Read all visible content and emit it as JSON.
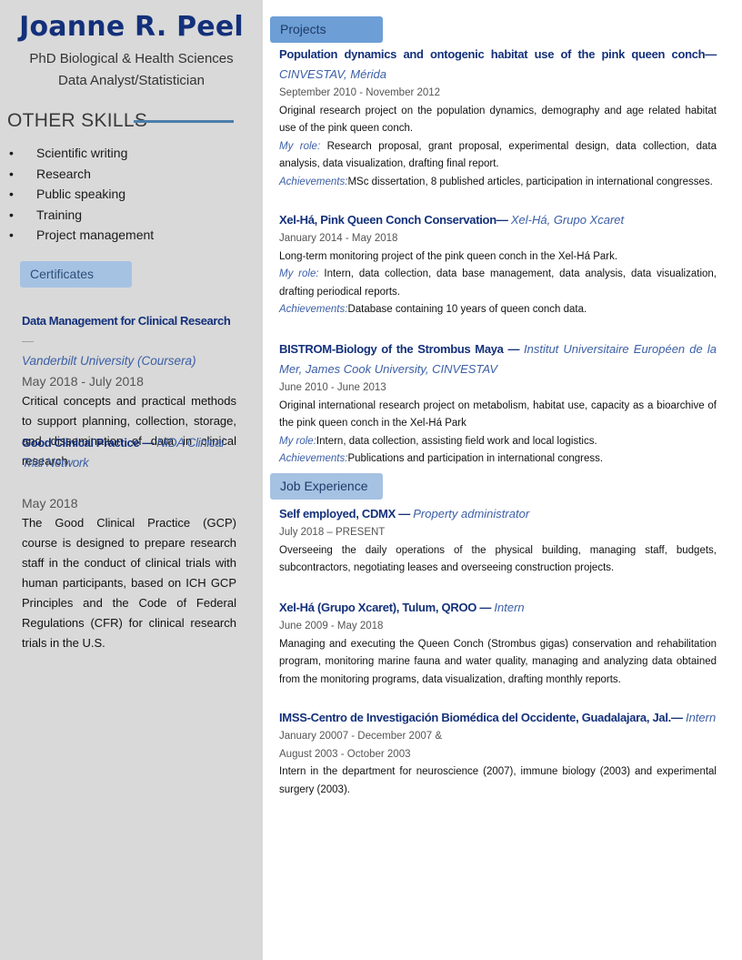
{
  "header": {
    "name": "Joanne R. Peel",
    "subtitle_1": "PhD Biological & Health Sciences",
    "subtitle_2": "Data Analyst/Statistician"
  },
  "skills": {
    "heading": "OTHER SKILLS",
    "items": [
      "Scientific writing",
      "Research",
      "Public speaking",
      "Training",
      "Project management"
    ]
  },
  "certificates": {
    "heading": "Certificates",
    "items": [
      {
        "title": "Data Management for Clinical Research",
        "dash": " —",
        "org": "Vanderbilt University (Coursera)",
        "date": "May 2018 - July 2018",
        "description": "Critical concepts and practical methods to support planning, collection, storage, and dissemination of data in clinical research."
      },
      {
        "title": "Good Clinical Practice",
        "dash": " — ",
        "org": "NIDA Clinical Trial Network",
        "date": "May 2018",
        "description": "The Good Clinical Practice (GCP) course is designed to prepare research staff in the conduct of clinical trials with human participants, based on ICH GCP Principles and the Code of Federal Regulations (CFR) for clinical research trials in the U.S."
      }
    ]
  },
  "projects": {
    "heading": "Projects",
    "role_label": "My role:",
    "achievements_label": "Achievements:",
    "items": [
      {
        "title": "Population dynamics and ontogenic habitat use of the pink queen conch",
        "dash": "—",
        "org": "CINVESTAV, Mérida",
        "date": "September 2010 - November 2012",
        "description": "Original research project on the population dynamics, demography and age related habitat use of the pink queen conch.",
        "role": "Research proposal, grant proposal, experimental design, data collection, data analysis, data visualization, drafting final report.",
        "achievements": "MSc dissertation, 8 published articles, participation in international congresses."
      },
      {
        "title": "Xel-Há, Pink Queen Conch Conservation",
        "dash": "— ",
        "org": "Xel-Há, Grupo Xcaret",
        "date": "January 2014 - May 2018",
        "description": "Long-term monitoring project of the pink queen conch in the Xel-Há Park.",
        "role": "Intern, data collection, data base management, data analysis, data visualization, drafting periodical reports.",
        "achievements": "Database containing 10 years of queen conch data."
      },
      {
        "title": "BISTROM-Biology of the Strombus Maya",
        "dash": " — ",
        "org": "Institut Universitaire Européen de la Mer, James Cook University, CINVESTAV",
        "date": "June 2010 - June 2013",
        "description": "Original international research project on metabolism, habitat use, capacity as a bioarchive of the pink queen conch in the Xel-Há Park",
        "role": "Intern, data collection, assisting field work and local logistics.",
        "achievements": "Publications and participation in international congress."
      }
    ]
  },
  "experience": {
    "heading": "Job Experience",
    "items": [
      {
        "title": "Self employed, CDMX",
        "dash": " — ",
        "org": "Property administrator",
        "date": "July 2018 – PRESENT",
        "description": "Overseeing the daily operations of the physical building, managing staff, budgets, subcontractors, negotiating leases and overseeing construction projects."
      },
      {
        "title": "Xel-Há (Grupo Xcaret), Tulum, QROO",
        "dash": " — ",
        "org": "Intern",
        "date": "June 2009 - May 2018",
        "description": "Managing and executing the Queen Conch (Strombus gigas) conservation and rehabilitation program, monitoring marine fauna and water quality, managing and analyzing data obtained from the monitoring programs, data visualization, drafting monthly reports."
      },
      {
        "title": "IMSS-Centro de Investigación Biomédica del Occidente, Guadalajara, Jal.",
        "dash": "— ",
        "org": "Intern",
        "date": "January 20007 - December 2007 &",
        "date_2": "August 2003 - October 2003",
        "description": "Intern in the department for neuroscience (2007), immune biology (2003) and experimental surgery (2003)."
      }
    ]
  }
}
